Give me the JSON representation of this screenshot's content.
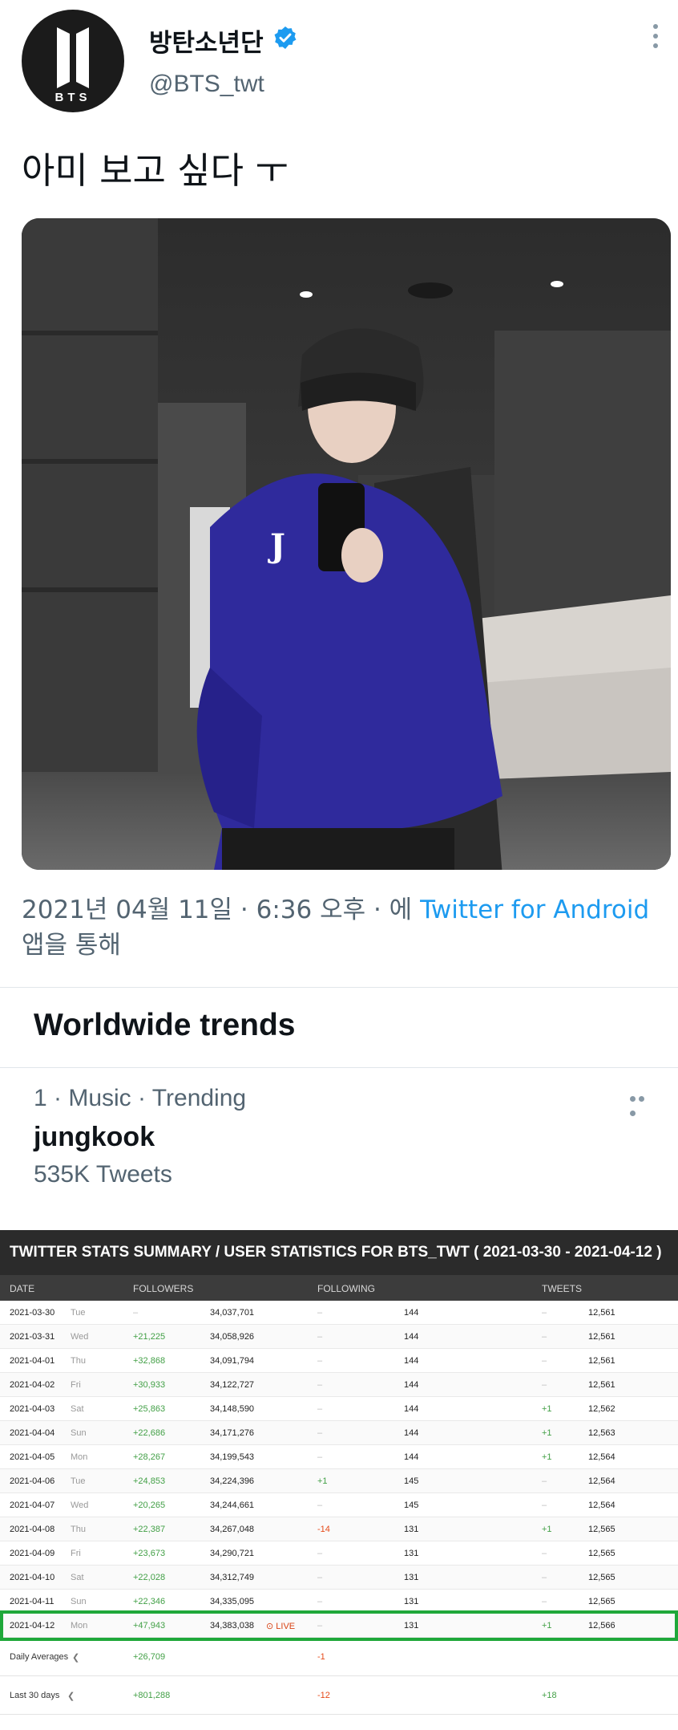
{
  "tweet": {
    "display_name": "방탄소년단",
    "handle": "@BTS_twt",
    "avatar_text": "BTS",
    "text": "아미 보고 싶다 ㅜ",
    "meta_prefix": "2021년 04월 11일 · 6:36 오후 · 에 ",
    "source": "Twitter for Android",
    "meta_suffix": " 앱을 통해"
  },
  "trends": {
    "title": "Worldwide trends",
    "item": {
      "meta": "1 · Music · Trending",
      "name": "jungkook",
      "count": "535K Tweets"
    }
  },
  "stats": {
    "title": "TWITTER STATS SUMMARY / USER STATISTICS FOR BTS_TWT ( 2021-03-30 - 2021-04-12 )",
    "headers": {
      "date": "DATE",
      "followers": "FOLLOWERS",
      "following": "FOLLOWING",
      "tweets": "TWEETS"
    },
    "rows": [
      {
        "date": "2021-03-30",
        "day": "Tue",
        "f_change": "–",
        "f_total": "34,037,701",
        "g_change": "–",
        "g_total": "144",
        "t_change": "–",
        "t_total": "12,561",
        "live": ""
      },
      {
        "date": "2021-03-31",
        "day": "Wed",
        "f_change": "+21,225",
        "f_total": "34,058,926",
        "g_change": "–",
        "g_total": "144",
        "t_change": "–",
        "t_total": "12,561",
        "live": ""
      },
      {
        "date": "2021-04-01",
        "day": "Thu",
        "f_change": "+32,868",
        "f_total": "34,091,794",
        "g_change": "–",
        "g_total": "144",
        "t_change": "–",
        "t_total": "12,561",
        "live": ""
      },
      {
        "date": "2021-04-02",
        "day": "Fri",
        "f_change": "+30,933",
        "f_total": "34,122,727",
        "g_change": "–",
        "g_total": "144",
        "t_change": "–",
        "t_total": "12,561",
        "live": ""
      },
      {
        "date": "2021-04-03",
        "day": "Sat",
        "f_change": "+25,863",
        "f_total": "34,148,590",
        "g_change": "–",
        "g_total": "144",
        "t_change": "+1",
        "t_total": "12,562",
        "live": ""
      },
      {
        "date": "2021-04-04",
        "day": "Sun",
        "f_change": "+22,686",
        "f_total": "34,171,276",
        "g_change": "–",
        "g_total": "144",
        "t_change": "+1",
        "t_total": "12,563",
        "live": ""
      },
      {
        "date": "2021-04-05",
        "day": "Mon",
        "f_change": "+28,267",
        "f_total": "34,199,543",
        "g_change": "–",
        "g_total": "144",
        "t_change": "+1",
        "t_total": "12,564",
        "live": ""
      },
      {
        "date": "2021-04-06",
        "day": "Tue",
        "f_change": "+24,853",
        "f_total": "34,224,396",
        "g_change": "+1",
        "g_total": "145",
        "t_change": "–",
        "t_total": "12,564",
        "live": ""
      },
      {
        "date": "2021-04-07",
        "day": "Wed",
        "f_change": "+20,265",
        "f_total": "34,244,661",
        "g_change": "–",
        "g_total": "145",
        "t_change": "–",
        "t_total": "12,564",
        "live": ""
      },
      {
        "date": "2021-04-08",
        "day": "Thu",
        "f_change": "+22,387",
        "f_total": "34,267,048",
        "g_change": "-14",
        "g_total": "131",
        "t_change": "+1",
        "t_total": "12,565",
        "live": ""
      },
      {
        "date": "2021-04-09",
        "day": "Fri",
        "f_change": "+23,673",
        "f_total": "34,290,721",
        "g_change": "–",
        "g_total": "131",
        "t_change": "–",
        "t_total": "12,565",
        "live": ""
      },
      {
        "date": "2021-04-10",
        "day": "Sat",
        "f_change": "+22,028",
        "f_total": "34,312,749",
        "g_change": "–",
        "g_total": "131",
        "t_change": "–",
        "t_total": "12,565",
        "live": ""
      },
      {
        "date": "2021-04-11",
        "day": "Sun",
        "f_change": "+22,346",
        "f_total": "34,335,095",
        "g_change": "–",
        "g_total": "131",
        "t_change": "–",
        "t_total": "12,565",
        "live": ""
      },
      {
        "date": "2021-04-12",
        "day": "Mon",
        "f_change": "+47,943",
        "f_total": "34,383,038",
        "g_change": "–",
        "g_total": "131",
        "t_change": "+1",
        "t_total": "12,566",
        "live": "⊙ LIVE"
      }
    ],
    "daily_avg": {
      "label": "Daily Averages",
      "followers": "+26,709",
      "following": "-1",
      "tweets": ""
    },
    "last_30": {
      "label": "Last 30 days",
      "followers": "+801,288",
      "following": "-12",
      "tweets": "+18"
    }
  },
  "colors": {
    "link": "#1d9bf0",
    "verified": "#1d9bf0",
    "positive": "#43a047",
    "negative": "#e64a19",
    "highlight": "#1fa83a"
  }
}
